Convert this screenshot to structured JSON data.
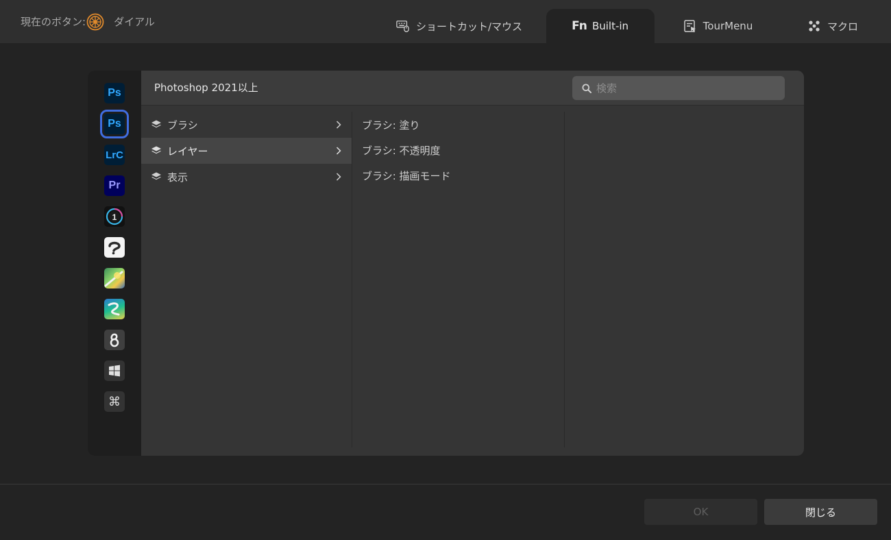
{
  "header": {
    "current_button_label": "現在のボタン:",
    "current_button_value": "ダイアル",
    "tabs": [
      {
        "label": "ショートカット/マウス",
        "icon": "keyboard-mouse-icon"
      },
      {
        "label": "Built-in",
        "icon": "fn-icon",
        "active": true
      },
      {
        "label": "TourMenu",
        "icon": "tourmenu-icon"
      },
      {
        "label": "マクロ",
        "icon": "macro-icon"
      }
    ]
  },
  "apps": [
    {
      "name": "Photoshop",
      "text": "Ps",
      "bg": "#001e36",
      "fg": "#31a8ff"
    },
    {
      "name": "Photoshop 2021",
      "text": "Ps",
      "bg": "#001e36",
      "fg": "#31a8ff",
      "selected": true
    },
    {
      "name": "Lightroom Classic",
      "text": "LrC",
      "bg": "#001e36",
      "fg": "#31a8ff"
    },
    {
      "name": "Premiere Pro",
      "text": "Pr",
      "bg": "#00005b",
      "fg": "#9999ff"
    },
    {
      "name": "Capture One",
      "icon": "capture-one-icon"
    },
    {
      "name": "Clip Studio Paint",
      "icon": "clip-studio-icon"
    },
    {
      "name": "Krita",
      "icon": "krita-icon"
    },
    {
      "name": "Rebelle",
      "icon": "rebelle-icon"
    },
    {
      "name": "Custom app",
      "icon": "app-6-icon"
    },
    {
      "name": "Windows",
      "icon": "windows-icon"
    },
    {
      "name": "System shortcuts",
      "icon": "command-icon"
    }
  ],
  "content": {
    "title": "Photoshop 2021以上",
    "search_placeholder": "検索",
    "categories": [
      {
        "label": "ブラシ"
      },
      {
        "label": "レイヤー",
        "selected": true
      },
      {
        "label": "表示"
      }
    ],
    "functions": [
      {
        "label": "ブラシ: 塗り"
      },
      {
        "label": "ブラシ: 不透明度"
      },
      {
        "label": "ブラシ: 描画モード"
      }
    ]
  },
  "footer": {
    "ok_label": "OK",
    "close_label": "閉じる"
  },
  "colors": {
    "accent": "#3f6de0",
    "dial": "#e08a2c"
  }
}
